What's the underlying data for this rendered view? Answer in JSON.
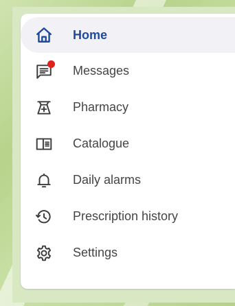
{
  "nav": {
    "items": [
      {
        "label": "Home",
        "icon": "home-icon",
        "active": true
      },
      {
        "label": "Messages",
        "icon": "messages-icon",
        "badge": true
      },
      {
        "label": "Pharmacy",
        "icon": "pharmacy-icon"
      },
      {
        "label": "Catalogue",
        "icon": "catalogue-icon"
      },
      {
        "label": "Daily alarms",
        "icon": "bell-icon"
      },
      {
        "label": "Prescription history",
        "icon": "history-icon"
      },
      {
        "label": "Settings",
        "icon": "gear-icon"
      }
    ]
  },
  "colors": {
    "accent": "#1d4a9b",
    "badge": "#e0201b",
    "active_bg": "#f2f1f6",
    "text": "#454545",
    "background": "#b9d58f"
  }
}
